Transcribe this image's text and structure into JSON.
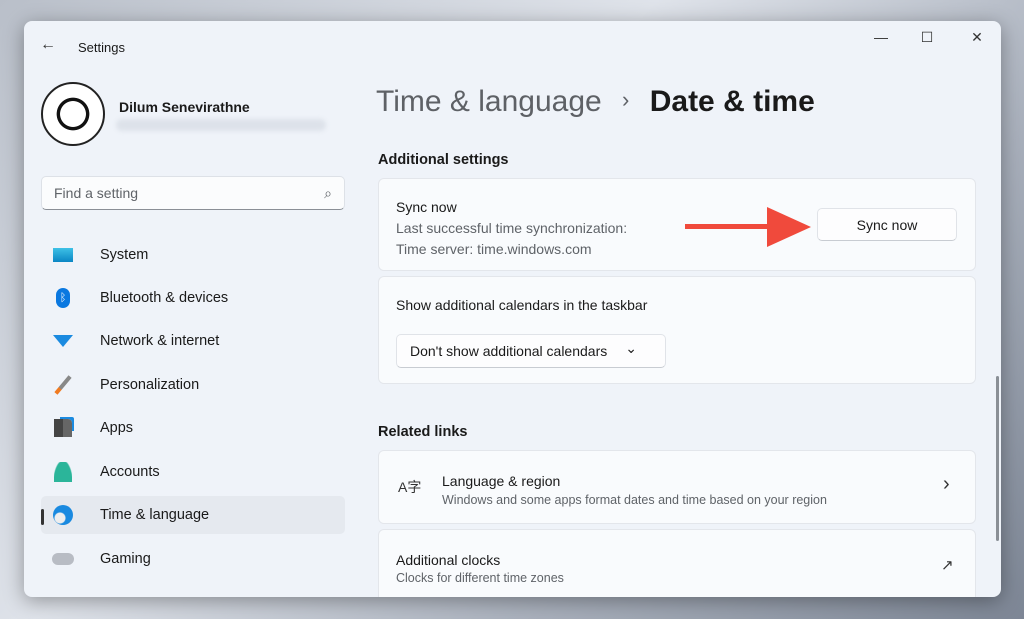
{
  "window": {
    "title": "Settings",
    "back": "←",
    "minimize": "—",
    "maximize": "☐",
    "close": "✕"
  },
  "user": {
    "name": "Dilum Senevirathne"
  },
  "search": {
    "placeholder": "Find a setting",
    "icon": "⌕"
  },
  "sidebar": {
    "items": [
      {
        "label": "System",
        "icon": "system-icon"
      },
      {
        "label": "Bluetooth & devices",
        "icon": "bluetooth-icon"
      },
      {
        "label": "Network & internet",
        "icon": "wifi-icon"
      },
      {
        "label": "Personalization",
        "icon": "brush-icon"
      },
      {
        "label": "Apps",
        "icon": "apps-icon"
      },
      {
        "label": "Accounts",
        "icon": "person-icon"
      },
      {
        "label": "Time & language",
        "icon": "globe-clock-icon"
      },
      {
        "label": "Gaming",
        "icon": "gamepad-icon"
      }
    ]
  },
  "breadcrumb": {
    "parent": "Time & language",
    "sep": "›",
    "current": "Date & time"
  },
  "additional": {
    "heading": "Additional settings",
    "sync": {
      "title": "Sync now",
      "last": "Last successful time synchronization:",
      "server": "Time server: time.windows.com",
      "button": "Sync now"
    },
    "calendars": {
      "title": "Show additional calendars in the taskbar",
      "value": "Don't show additional calendars",
      "chev": "⌄"
    }
  },
  "related": {
    "heading": "Related links",
    "items": [
      {
        "title": "Language & region",
        "desc": "Windows and some apps format dates and time based on your region",
        "arrow": "›",
        "icon": "A字"
      },
      {
        "title": "Additional clocks",
        "desc": "Clocks for different time zones",
        "arrow": "↗"
      }
    ]
  },
  "colors": {
    "accent": "#0067c0",
    "arrow": "#f04a3c"
  }
}
